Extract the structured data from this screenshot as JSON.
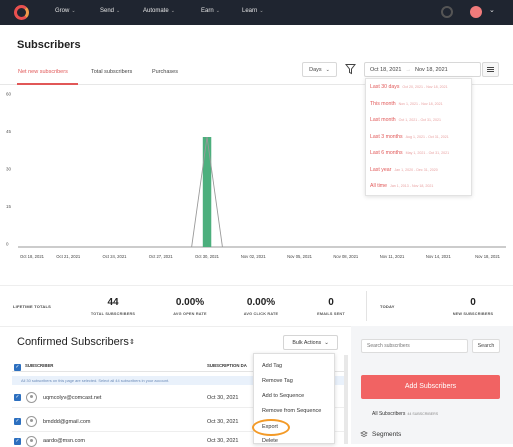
{
  "nav": {
    "items": [
      "Grow",
      "Send",
      "Automate",
      "Earn",
      "Learn"
    ],
    "colors": {
      "bg": "#1f2530",
      "accent": "#e8504f"
    }
  },
  "page": {
    "title": "Subscribers"
  },
  "tabs": [
    {
      "label": "Net new subscribers",
      "active": true
    },
    {
      "label": "Total subscribers",
      "active": false
    },
    {
      "label": "Purchases",
      "active": false
    }
  ],
  "controls": {
    "period_select": "Days",
    "range_start": "Oct 18, 2021",
    "range_sep": "→",
    "range_end": "Nov 18, 2021"
  },
  "date_presets": [
    {
      "label": "Last 30 days",
      "range": "Oct 20, 2021 - Nov 18, 2021"
    },
    {
      "label": "This month",
      "range": "Nov 1, 2021 - Nov 18, 2021"
    },
    {
      "label": "Last month",
      "range": "Oct 1, 2021 - Oct 31, 2021"
    },
    {
      "label": "Last 3 months",
      "range": "Aug 1, 2021 - Oct 31, 2021"
    },
    {
      "label": "Last 6 months",
      "range": "May 1, 2021 - Oct 31, 2021"
    },
    {
      "label": "Last year",
      "range": "Jan 1, 2020 - Dec 31, 2020"
    },
    {
      "label": "All time",
      "range": "Jan 1, 2013 - Nov 18, 2021"
    }
  ],
  "chart_data": {
    "type": "bar",
    "categories": [
      "Oct 18, 2021",
      "Oct 19, 2021",
      "Oct 20, 2021",
      "Oct 21, 2021",
      "Oct 22, 2021",
      "Oct 23, 2021",
      "Oct 24, 2021",
      "Oct 25, 2021",
      "Oct 26, 2021",
      "Oct 27, 2021",
      "Oct 28, 2021",
      "Oct 29, 2021",
      "Oct 30, 2021",
      "Oct 31, 2021",
      "Nov 01, 2021",
      "Nov 02, 2021",
      "Nov 03, 2021",
      "Nov 04, 2021",
      "Nov 05, 2021",
      "Nov 06, 2021",
      "Nov 07, 2021",
      "Nov 08, 2021",
      "Nov 09, 2021",
      "Nov 10, 2021",
      "Nov 11, 2021",
      "Nov 12, 2021",
      "Nov 13, 2021",
      "Nov 14, 2021",
      "Nov 15, 2021",
      "Nov 16, 2021",
      "Nov 17, 2021",
      "Nov 18, 2021"
    ],
    "values": [
      0,
      0,
      0,
      0,
      0,
      0,
      0,
      0,
      0,
      0,
      0,
      0,
      44,
      0,
      0,
      0,
      0,
      0,
      0,
      0,
      0,
      0,
      0,
      0,
      0,
      0,
      0,
      0,
      0,
      0,
      0,
      0
    ],
    "x_tick_labels": [
      "Oct 18, 2021",
      "Oct 21, 2021",
      "Oct 24, 2021",
      "Oct 27, 2021",
      "Oct 30, 2021",
      "Nov 02, 2021",
      "Nov 05, 2021",
      "Nov 08, 2021",
      "Nov 11, 2021",
      "Nov 14, 2021",
      "Nov 18, 2021"
    ],
    "y_ticks": [
      0,
      15,
      30,
      45,
      60
    ],
    "ylim": [
      0,
      60
    ],
    "bar_color": "#4caf7d",
    "line_color": "#999999"
  },
  "stats": {
    "lifetime_label": "LIFETIME TOTALS",
    "total_subscribers": {
      "value": "44",
      "label": "TOTAL SUBSCRIBERS"
    },
    "open_rate": {
      "value": "0.00%",
      "label": "AVG OPEN RATE"
    },
    "click_rate": {
      "value": "0.00%",
      "label": "AVG CLICK RATE"
    },
    "emails_sent": {
      "value": "0",
      "label": "EMAILS SENT"
    },
    "today_label": "TODAY",
    "new_subscribers": {
      "value": "0",
      "label": "NEW SUBSCRIBERS"
    }
  },
  "list": {
    "title": "Confirmed Subscribers",
    "sort_glyph": "⇕",
    "bulk_label": "Bulk Actions",
    "col_subscriber": "SUBSCRIBER",
    "col_date": "SUBSCRIPTION DA",
    "notice": "All 30 subscribers on this page are selected. Select all 44 subscribers in your account.",
    "rows": [
      {
        "email": "uqmcolyv@comcast.net",
        "date": "Oct 30, 2021"
      },
      {
        "email": "bmddd@gmail.com",
        "date": "Oct 30, 2021"
      },
      {
        "email": "aardo@msn.com",
        "date": "Oct 30, 2021"
      }
    ]
  },
  "bulk_menu": [
    "Add Tag",
    "Remove Tag",
    "Add to Sequence",
    "Remove from Sequence",
    "Export",
    "Delete"
  ],
  "sidebar": {
    "search_placeholder": "Search subscribers",
    "search_button": "Search",
    "add_button": "Add Subscribers",
    "all_subscribers": "All Subscribers",
    "all_subscribers_count": "44 SUBSCRIBERS",
    "segments": "Segments"
  }
}
